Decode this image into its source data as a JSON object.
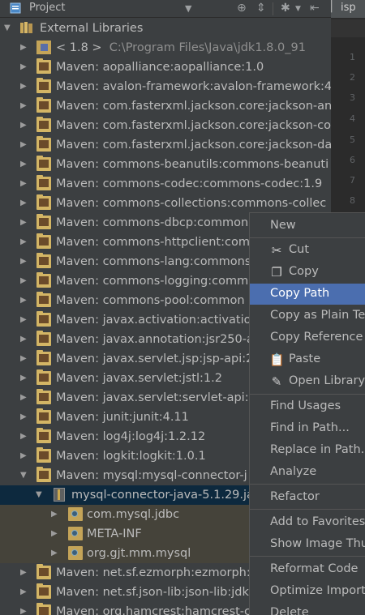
{
  "header": {
    "title": "Project",
    "icons": [
      "project-icon",
      "chevron-down-icon",
      "locate-icon",
      "collapse-icon",
      "gear-icon",
      "hide-icon"
    ]
  },
  "editor": {
    "tab_label": "isp",
    "line_numbers": [
      "1",
      "2",
      "3",
      "4",
      "5",
      "6",
      "7",
      "8"
    ]
  },
  "tree": {
    "root_label": "External Libraries",
    "jdk": {
      "version": "< 1.8 >",
      "path": "C:\\Program Files\\Java\\jdk1.8.0_91"
    },
    "libraries": [
      "Maven: aopalliance:aopalliance:1.0",
      "Maven: avalon-framework:avalon-framework:4.",
      "Maven: com.fasterxml.jackson.core:jackson-ann",
      "Maven: com.fasterxml.jackson.core:jackson-co",
      "Maven: com.fasterxml.jackson.core:jackson-da",
      "Maven: commons-beanutils:commons-beanuti",
      "Maven: commons-codec:commons-codec:1.9",
      "Maven: commons-collections:commons-collec",
      "Maven: commons-dbcp:common",
      "Maven: commons-httpclient:com",
      "Maven: commons-lang:commons",
      "Maven: commons-logging:comm",
      "Maven: commons-pool:common",
      "Maven: javax.activation:activatio",
      "Maven: javax.annotation:jsr250-a",
      "Maven: javax.servlet.jsp:jsp-api:2",
      "Maven: javax.servlet:jstl:1.2",
      "Maven: javax.servlet:servlet-api:2",
      "Maven: junit:junit:4.11",
      "Maven: log4j:log4j:1.2.12",
      "Maven: logkit:logkit:1.0.1",
      "Maven: mysql:mysql-connector-j"
    ],
    "jar": "mysql-connector-java-5.1.29.ja",
    "packages": [
      "com.mysql.jdbc",
      "META-INF",
      "org.gjt.mm.mysql"
    ],
    "after": [
      "Maven: net.sf.ezmorph:ezmorph:",
      "Maven: net.sf.json-lib:json-lib:jdk",
      "Maven: org.hamcrest:hamcrest-c"
    ]
  },
  "context_menu": {
    "items": [
      {
        "label": "New"
      },
      {
        "label": "Cut",
        "icon": "scissors-icon"
      },
      {
        "label": "Copy",
        "icon": "copy-icon"
      },
      {
        "label": "Copy Path",
        "active": true
      },
      {
        "label": "Copy as Plain Te"
      },
      {
        "label": "Copy Reference"
      },
      {
        "label": "Paste",
        "icon": "paste-icon"
      },
      {
        "label": "Open Library"
      },
      {
        "label": "Find Usages"
      },
      {
        "label": "Find in Path..."
      },
      {
        "label": "Replace in Path.."
      },
      {
        "label": "Analyze"
      },
      {
        "label": "Refactor"
      },
      {
        "label": "Add to Favorites"
      },
      {
        "label": "Show Image Thu"
      },
      {
        "label": "Reformat Code"
      },
      {
        "label": "Optimize Import"
      },
      {
        "label": "Delete"
      }
    ]
  }
}
